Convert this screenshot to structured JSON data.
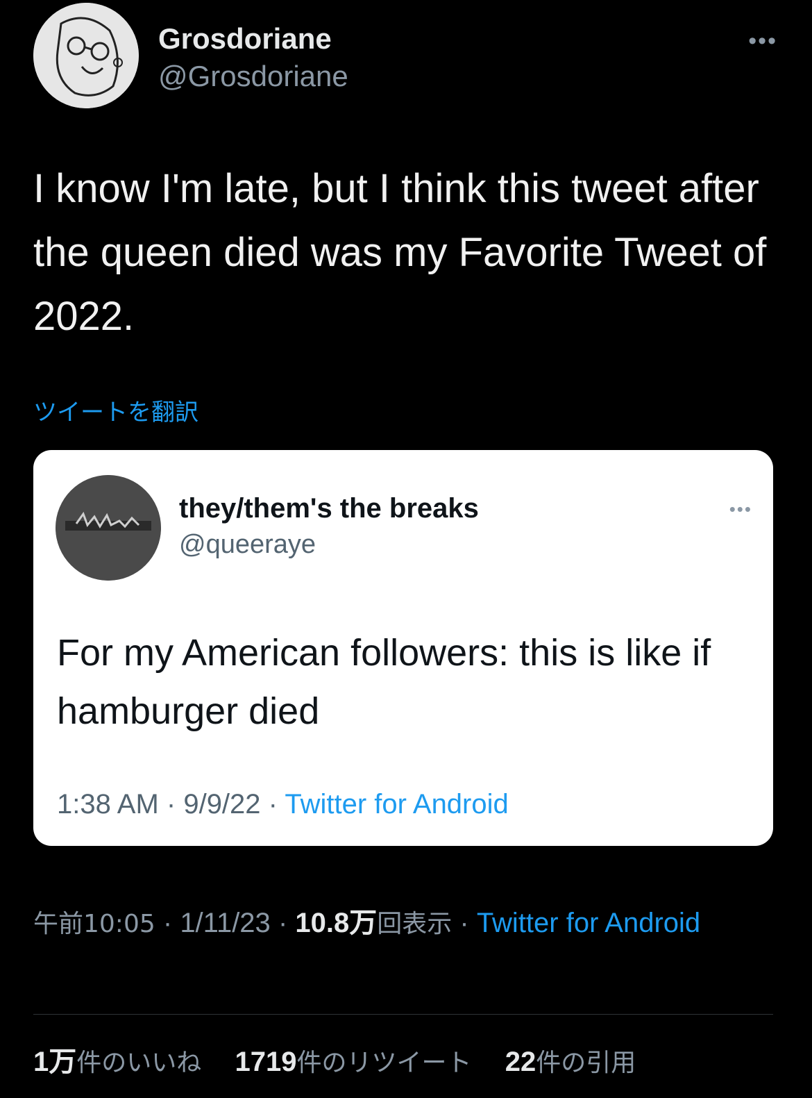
{
  "author": {
    "display_name": "Grosdoriane",
    "handle": "@Grosdoriane"
  },
  "tweet_text": "I know I'm late, but I think this tweet after the queen died was my Favorite Tweet of 2022.",
  "translate_label": "ツイートを翻訳",
  "quoted": {
    "display_name": "they/them's the breaks",
    "handle": "@queeraye",
    "text": "For my American followers: this is like if hamburger died",
    "time": "1:38 AM",
    "date": "9/9/22",
    "source": "Twitter for Android"
  },
  "meta": {
    "time": "午前10:05",
    "date": "1/11/23",
    "views_value": "10.8万",
    "views_label": "回表示",
    "source": "Twitter for Android"
  },
  "stats": {
    "likes_value": "1万",
    "likes_label": "件のいいね",
    "retweets_value": "1719",
    "retweets_label": "件のリツイート",
    "quotes_value": "22",
    "quotes_label": "件の引用"
  },
  "icons": {
    "more": "more-horizontal-icon"
  },
  "colors": {
    "accent": "#1d9bf0",
    "background": "#000000",
    "card": "#ffffff"
  }
}
